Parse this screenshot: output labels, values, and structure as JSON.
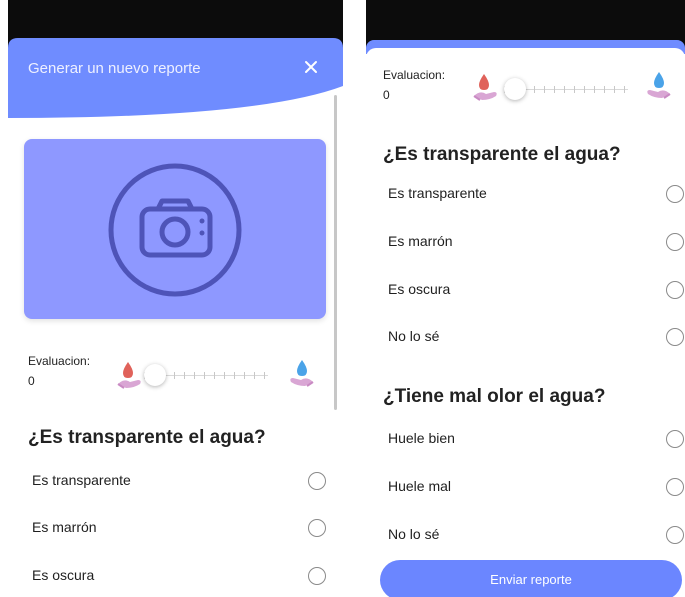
{
  "left_screen": {
    "header": {
      "title": "Generar un nuevo reporte",
      "close_icon": "close-icon",
      "color": "#6f8cff"
    },
    "photo": {
      "icon": "camera-icon",
      "background": "#8e98ff"
    },
    "evaluation": {
      "label": "Evaluacion:",
      "value": "0",
      "slider_level": 0
    },
    "question": "¿Es transparente el agua?",
    "options": [
      "Es transparente",
      "Es marrón",
      "Es oscura"
    ]
  },
  "right_screen": {
    "evaluation": {
      "label": "Evaluacion:",
      "value": "0",
      "slider_level": 0
    },
    "question_1": {
      "title": "¿Es transparente el agua?",
      "options": [
        "Es transparente",
        "Es marrón",
        "Es oscura",
        "No lo sé"
      ]
    },
    "question_2": {
      "title": "¿Tiene mal olor el agua?",
      "options": [
        "Huele bien",
        "Huele mal",
        "No lo sé"
      ]
    },
    "submit_label": "Enviar reporte"
  },
  "colors": {
    "accent": "#6f8cff",
    "photo_card": "#8e98ff",
    "dirty_drop": "#e0625a",
    "clean_drop": "#4aa3e8",
    "hand": "#d9a6d4"
  }
}
